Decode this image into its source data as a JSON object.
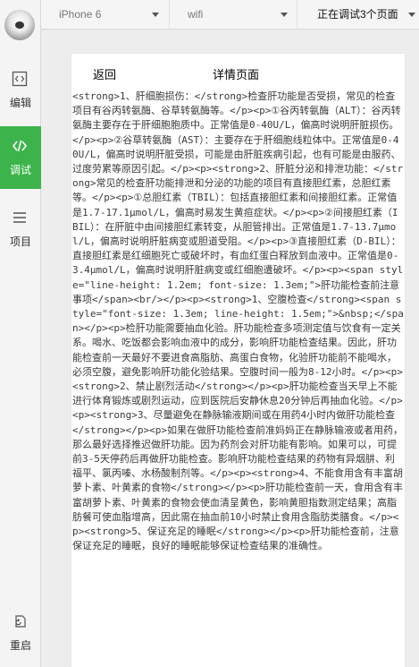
{
  "sidebar": {
    "items": [
      {
        "label": "编辑",
        "icon": "code-file-icon"
      },
      {
        "label": "调试",
        "icon": "code-brackets-icon",
        "active": true
      },
      {
        "label": "项目",
        "icon": "hamburger-menu-icon"
      },
      {
        "label": "重启",
        "icon": "restart-icon"
      }
    ]
  },
  "toolbar": {
    "device": "iPhone 6",
    "network": "wifi",
    "pages_status": "正在调试3个页面"
  },
  "page": {
    "back_label": "返回",
    "title": "详情页面",
    "content": "<strong>1、肝细胞损伤：</strong>检查肝功能是否受损，常见的检查项目有谷丙转氨酶、谷草转氨酶等。</p><p>①谷丙转氨酶（ALT）：谷丙转氨酶主要存在于肝细胞胞质中。正常值是0-40U/L，偏高时说明肝脏损伤。</p><p>②谷草转氨酶（AST）：主要存在于肝细胞线粒体中。正常值是0-40U/L，偏高时说明肝脏受损，可能是由肝脏疾病引起，也有可能是由服药、过度劳累等原因引起。</p><p><strong>2、肝脏分泌和排泄功能：</strong>常见的检查肝功能排泄和分泌的功能的项目有直接胆红素，总胆红素等。</p><p>①总胆红素（TBIL）：包括直接胆红素和间接胆红素。正常值是1.7-17.1μmol/L，偏高时易发生黄疸症状。</p><p>②间接胆红素（IBIL）：在肝脏中由间接胆红素转变，从胆管排出。正常值是1.7-13.7μmol/L，偏高时说明肝脏病变或胆道受阻。</p><p>③直接胆红素（D-BIL）：直接胆红素是红细胞死亡或破坏时，有血红蛋白释放到血液中。正常值是0-3.4μmol/L，偏高时说明肝脏病变或红细胞遭破坏。</p><p><span style=\"line-height: 1.2em; font-size: 1.3em;\">肝功能检查前注意事项</span><br/></p><p><strong>1、空腹检查</strong><span style=\"font-size: 1.3em; line-height: 1.5em;\">&nbsp;</span></p><p>检肝功能需要抽血化验。肝功能检查多项测定值与饮食有一定关系。喝水、吃饭都会影响血液中的成分，影响肝功能检查结果。因此，肝功能检查前一天最好不要进食高脂肪、高蛋白食物，化验肝功能前不能喝水，必须空腹，避免影响肝功能化验结果。空腹时间一般为8-12小时。</p><p><strong>2、禁止剧烈活动</strong></p><p>肝功能检查当天早上不能进行体育锻炼或剧烈运动，应到医院后安静休息20分钟后再抽血化验。</p><p><strong>3、尽量避免在静脉输液期间或在用药4小时内做肝功能检查</strong></p><p>如果在做肝功能检查前准妈妈正在静脉输液或者用药，那么最好选择推迟做肝功能。因为药剂会对肝功能有影响。如果可以，可提前3-5天停药后再做肝功能检查。影响肝功能检查结果的药物有异烟肼、利福平、氯丙嗪、水杨酸制剂等。</p><p><strong>4、不能食用含有丰富胡萝卜素、叶黄素的食物</strong></p><p>肝功能检查前一天，食用含有丰富胡萝卜素、叶黄素的食物会使血清呈黄色，影响黄胆指数测定结果；高脂肪餐可使血脂增高，因此需在抽血前10小时禁止食用含脂肪类膳食。</p><p><strong>5、保证充足的睡眠</strong></p><p>肝功能检查前，注意保证充足的睡眠，良好的睡眠能够保证检查结果的准确性。"
  }
}
